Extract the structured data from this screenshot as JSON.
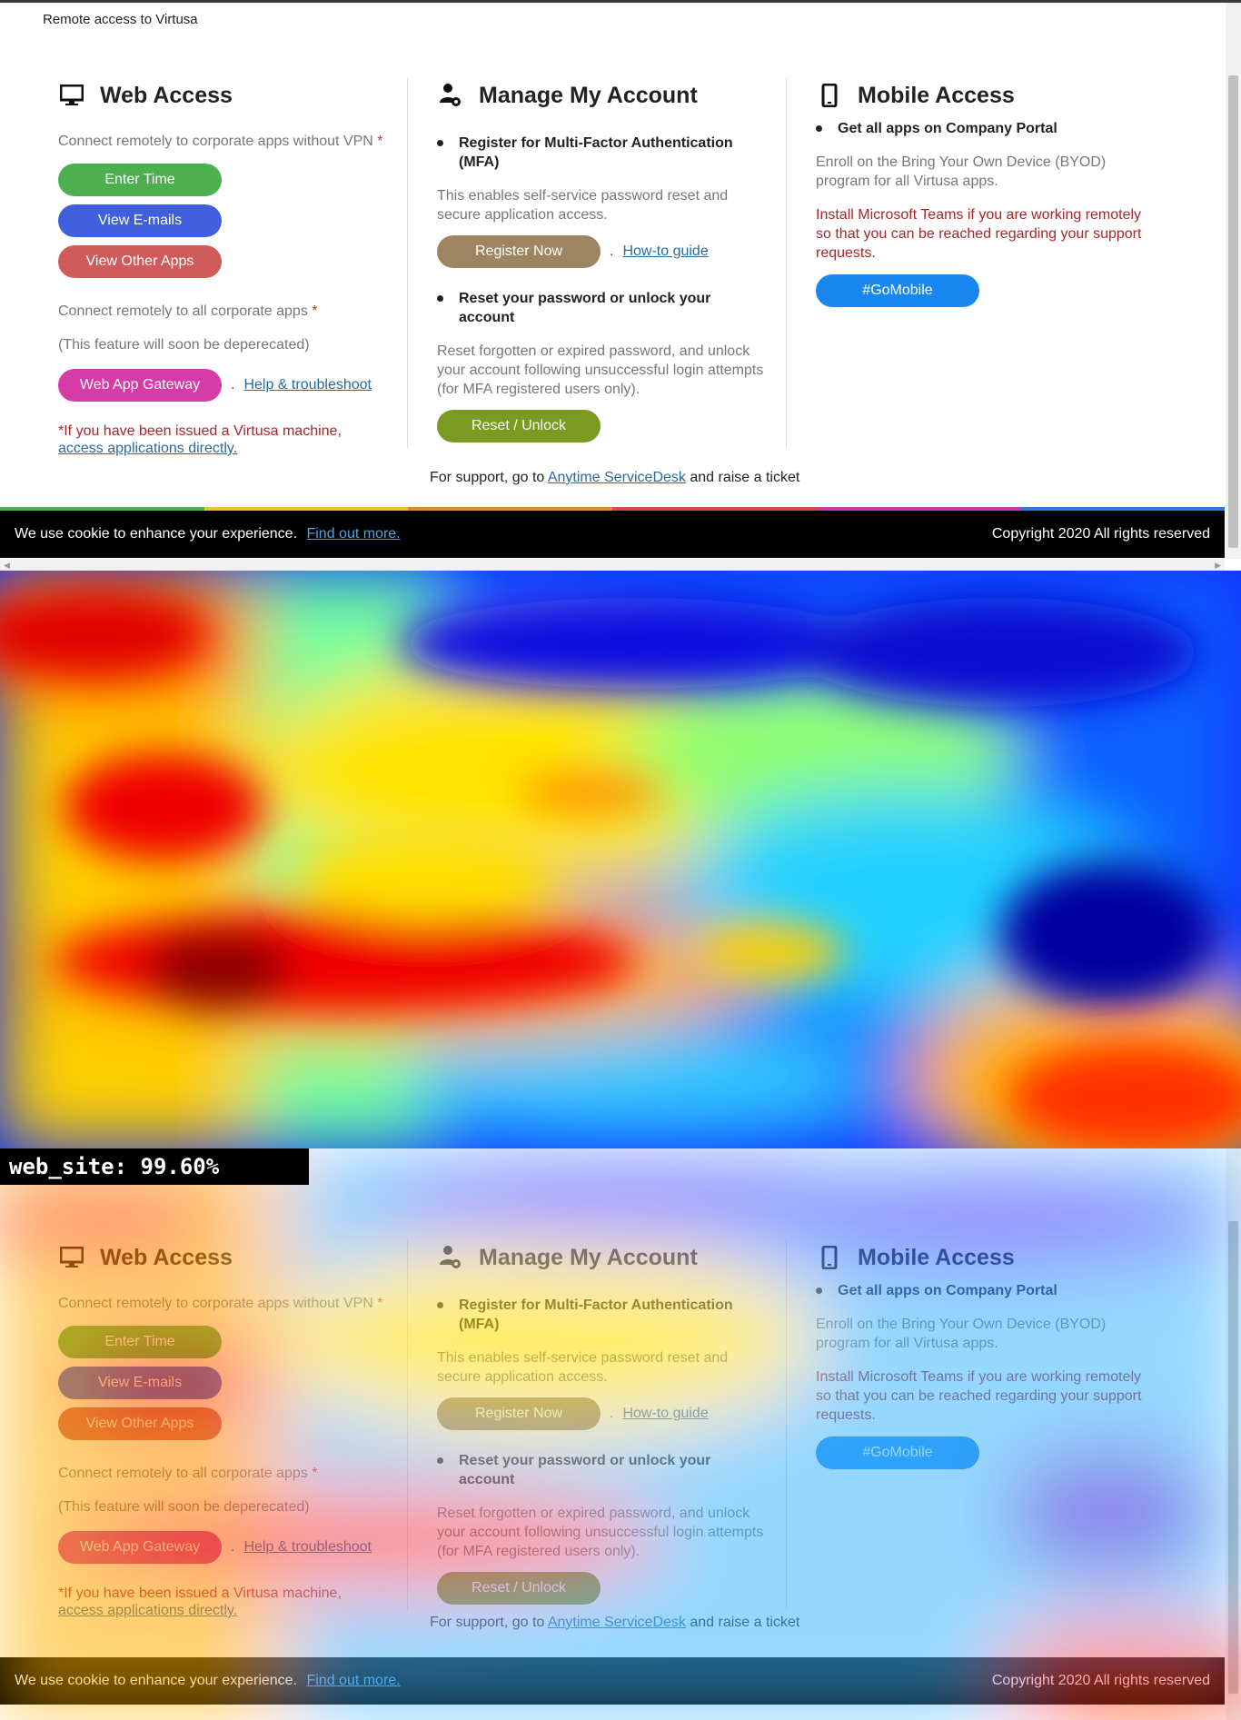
{
  "page": {
    "title": "Remote access to Virtusa"
  },
  "web_access": {
    "heading": "Web Access",
    "icon": "monitor-icon",
    "vpn_text": "Connect remotely to corporate apps without VPN",
    "asterisk": "*",
    "buttons": [
      {
        "label": "Enter Time",
        "color": "#4caf50"
      },
      {
        "label": "View E-mails",
        "color": "#3f5fdc"
      },
      {
        "label": "View Other Apps",
        "color": "#cf5b5b"
      }
    ],
    "all_apps_text": "Connect remotely to all corporate apps",
    "deprecated_text": "(This feature will soon be deperecated)",
    "gateway_button": {
      "label": "Web App Gateway",
      "color": "#d63ca8"
    },
    "separator": ".",
    "help_link": "Help & troubleshoot",
    "machine_note": "*If you have been issued a Virtusa machine,",
    "machine_link": "access applications directly."
  },
  "manage_account": {
    "heading": "Manage My Account",
    "icon": "user-gear-icon",
    "mfa_title": "Register for Multi-Factor Authentication (MFA)",
    "mfa_desc": "This enables self-service password reset and secure application access.",
    "register_button": {
      "label": "Register Now",
      "color": "#9c8560"
    },
    "separator": ".",
    "howto_link": "How-to guide",
    "reset_title": "Reset your password or unlock your account",
    "reset_desc": "Reset forgotten or expired password, and unlock your account following unsuccessful login attempts (for MFA registered users only).",
    "reset_button": {
      "label": "Reset / Unlock",
      "color": "#7a9a22"
    },
    "support_prefix": "For support, go to",
    "support_link": "Anytime ServiceDesk",
    "support_suffix": "and raise a ticket"
  },
  "mobile_access": {
    "heading": "Mobile Access",
    "icon": "phone-icon",
    "portal_title": "Get all apps on Company Portal",
    "byod_text": "Enroll on the Bring Your Own Device (BYOD) program for all Virtusa apps.",
    "teams_note": "Install Microsoft Teams if you are working remotely so that you can be reached regarding your support requests.",
    "gomobile_button": {
      "label": "#GoMobile",
      "color": "#1a86f0"
    }
  },
  "cookie_bar": {
    "text": "We use cookie to enhance your experience.",
    "link": "Find out more.",
    "copyright": "Copyright 2020 All rights reserved"
  },
  "prediction": {
    "label": "web_site: 99.60%"
  },
  "colors": {
    "rainbow": [
      "#4caf50",
      "#e6c530",
      "#e08a2a",
      "#d64a4a",
      "#c83ca8",
      "#2a7ae0"
    ]
  }
}
